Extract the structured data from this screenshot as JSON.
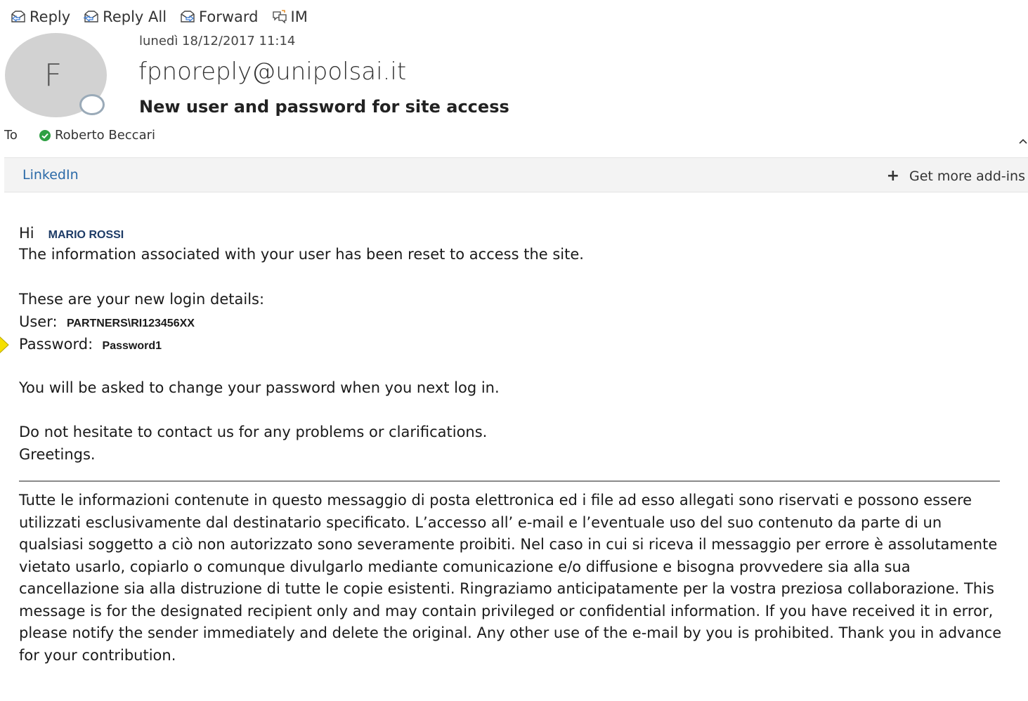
{
  "toolbar": {
    "reply_label": "Reply",
    "reply_all_label": "Reply All",
    "forward_label": "Forward",
    "im_label": "IM"
  },
  "header": {
    "avatar_initial": "F",
    "date": "lunedì 18/12/2017 11:14",
    "sender": "fpnoreply@unipolsai.it",
    "subject": "New user and password for site access",
    "to_label": "To",
    "recipient": "Roberto Beccari"
  },
  "addins": {
    "linkedin_label": "LinkedIn",
    "get_more_label": "Get more add-ins"
  },
  "message": {
    "greeting": "Hi",
    "recipient_name": "MARIO ROSSI",
    "line1": "The information associated with your user has been reset to access the site.",
    "line2": "These are your new login details:",
    "user_label": "User:",
    "user_value": "PARTNERS\\RI123456XX",
    "password_label": "Password:",
    "password_value": "Password1",
    "line3": "You will be asked to change your password when you next log in.",
    "line4": "Do not hesitate to contact us for any problems or clarifications.",
    "line5": "Greetings."
  },
  "disclaimer": {
    "text": "Tutte le informazioni contenute in questo messaggio di posta elettronica ed i file ad esso allegati sono riservati e possono essere utilizzati esclusivamente dal destinatario specificato. L’accesso all’ e-mail e l’eventuale uso del suo contenuto da parte di un qualsiasi soggetto a ciò non autorizzato sono severamente proibiti. Nel caso in cui si riceva il messaggio per errore è assolutamente vietato usarlo, copiarlo o comunque divulgarlo mediante comunicazione e/o diffusione e bisogna provvedere sia alla sua cancellazione sia alla distruzione di tutte le copie esistenti. Ringraziamo anticipatamente per la vostra preziosa collaborazione. This message is for the designated recipient only and may contain privileged or confidential information. If you have received it in error, please notify the sender immediately and delete the original. Any other use of the e-mail by you is prohibited. Thank you in advance for your contribution."
  },
  "colors": {
    "link": "#2b6aa8",
    "presence_ok": "#2ea043",
    "avatar_bg": "#d2d2d2",
    "marker": "#f5e000"
  }
}
